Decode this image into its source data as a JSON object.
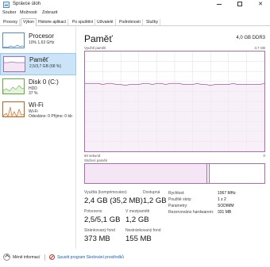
{
  "window": {
    "title": "Správce úloh",
    "minimize": "–",
    "maximize": "□",
    "close": "✕"
  },
  "menu": [
    "Soubor",
    "Možnosti",
    "Zobrazit"
  ],
  "tabs": [
    "Procesy",
    "Výkon",
    "Historie aplikací",
    "Po spuštění",
    "Uživatelé",
    "Podrobnosti",
    "Služby"
  ],
  "active_tab": "Výkon",
  "sidebar": [
    {
      "title": "Procesor",
      "sub1": "10% 1,63 GHz",
      "sub2": "",
      "icon": "cpu-graph"
    },
    {
      "title": "Paměť",
      "sub1": "2,5/3,7 GB (68 %)",
      "sub2": "",
      "icon": "memory-graph"
    },
    {
      "title": "Disk 0 (C:)",
      "sub1": "HDD",
      "sub2": "37 %",
      "icon": "disk-graph"
    },
    {
      "title": "Wi-Fi",
      "sub1": "Wi-Fi",
      "sub2": "Odesláno: 0 Přijmo: 0 kb",
      "icon": "network-graph"
    }
  ],
  "main": {
    "title": "Paměť",
    "capacity": "4,0 GB DDR3",
    "usage_label": "Využití paměti",
    "usage_max": "3,7 GB",
    "axis_left": "60 sekund",
    "axis_right": "0",
    "composition_label": "Složení paměti",
    "usage_fraction": 0.68
  },
  "stats": {
    "in_use": {
      "label": "Využitá (komprimováno)",
      "value": "2,4 GB (35,2 MB)"
    },
    "available": {
      "label": "Dostupná",
      "value": "1,2 GB"
    },
    "committed": {
      "label": "Potvrzeno",
      "value": "2,5/5,1 GB"
    },
    "cached": {
      "label": "V mezipaměti",
      "value": "1,2 GB"
    },
    "paged_pool": {
      "label": "Stránkovaný fond",
      "value": "373 MB"
    },
    "nonpaged_pool": {
      "label": "Nestránkovaný fond",
      "value": "155 MB"
    }
  },
  "properties": [
    {
      "key": "Rychlost:",
      "value": "1067 MHz"
    },
    {
      "key": "Použité sloty:",
      "value": "1 z 2"
    },
    {
      "key": "Parametry:",
      "value": "SODIMM"
    },
    {
      "key": "Rezervováno hardwarem:",
      "value": "331 MB"
    }
  ],
  "footer": {
    "less_info": "Méně informací",
    "resource_monitor": "Spustit program Sledování prostředků"
  },
  "colors": {
    "memory_accent": "#a86ea8",
    "memory_fill": "#f4e6f4",
    "cpu_accent": "#4f8fc9",
    "disk_accent": "#5fae3f",
    "network_accent": "#b5651d",
    "selection": "#cce4f7",
    "link": "#1a5fb4"
  },
  "memory_usage_history_percent": [
    68,
    68,
    68,
    68,
    67,
    68,
    68,
    67,
    67,
    66,
    67,
    67,
    67,
    68,
    68,
    67,
    68,
    68,
    67,
    68,
    68,
    68,
    67,
    67,
    67,
    68,
    67,
    67,
    66,
    67,
    67,
    67,
    67,
    68,
    67,
    67,
    67,
    67,
    67,
    67,
    68
  ]
}
